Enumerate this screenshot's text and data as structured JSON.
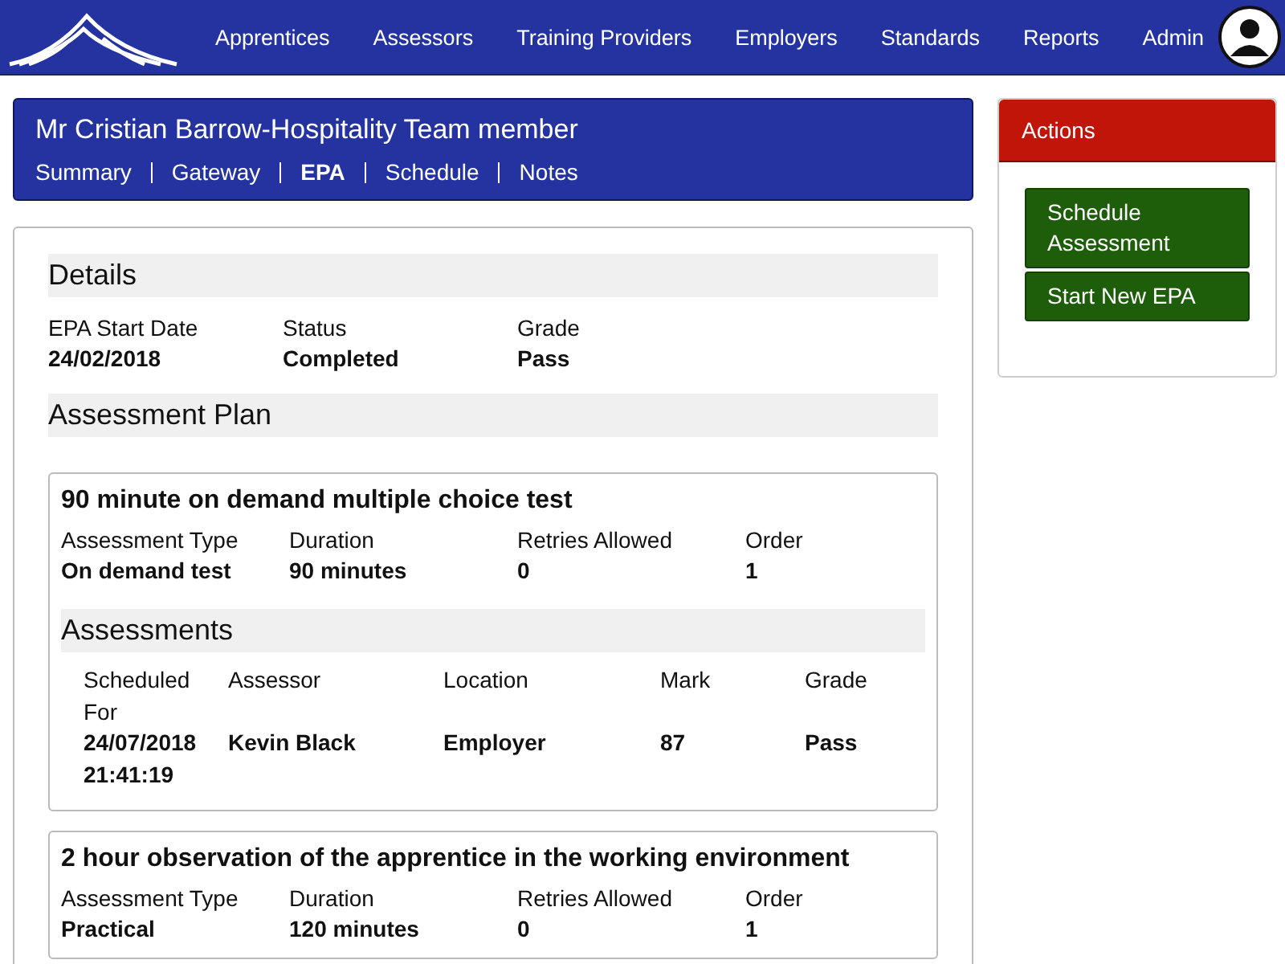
{
  "nav": {
    "items": [
      "Apprentices",
      "Assessors",
      "Training Providers",
      "Employers",
      "Standards",
      "Reports",
      "Admin"
    ]
  },
  "header": {
    "title": "Mr Cristian Barrow-Hospitality Team member",
    "tabs": [
      {
        "label": "Summary",
        "selected": false
      },
      {
        "label": "Gateway",
        "selected": false
      },
      {
        "label": "EPA",
        "selected": true
      },
      {
        "label": "Schedule",
        "selected": false
      },
      {
        "label": "Notes",
        "selected": false
      }
    ]
  },
  "details": {
    "title": "Details",
    "fields": [
      {
        "label": "EPA Start Date",
        "value": "24/02/2018"
      },
      {
        "label": "Status",
        "value": "Completed"
      },
      {
        "label": "Grade",
        "value": "Pass"
      }
    ]
  },
  "assessment_plan": {
    "title": "Assessment Plan",
    "plans": [
      {
        "title": "90 minute on demand multiple choice test",
        "fields": [
          {
            "label": "Assessment Type",
            "value": "On demand test"
          },
          {
            "label": "Duration",
            "value": "90 minutes"
          },
          {
            "label": "Retries Allowed",
            "value": "0"
          },
          {
            "label": "Order",
            "value": "1"
          }
        ],
        "assessments": {
          "title": "Assessments",
          "columns": [
            "Scheduled For",
            "Assessor",
            "Location",
            "Mark",
            "Grade"
          ],
          "rows": [
            [
              "24/07/2018 21:41:19",
              "Kevin Black",
              "Employer",
              "87",
              "Pass"
            ]
          ]
        }
      },
      {
        "title": "2 hour observation of the apprentice in the working environment",
        "fields": [
          {
            "label": "Assessment Type",
            "value": "Practical"
          },
          {
            "label": "Duration",
            "value": "120 minutes"
          },
          {
            "label": "Retries Allowed",
            "value": "0"
          },
          {
            "label": "Order",
            "value": "1"
          }
        ]
      }
    ]
  },
  "actions": {
    "title": "Actions",
    "buttons": [
      "Schedule Assessment",
      "Start New EPA"
    ]
  }
}
